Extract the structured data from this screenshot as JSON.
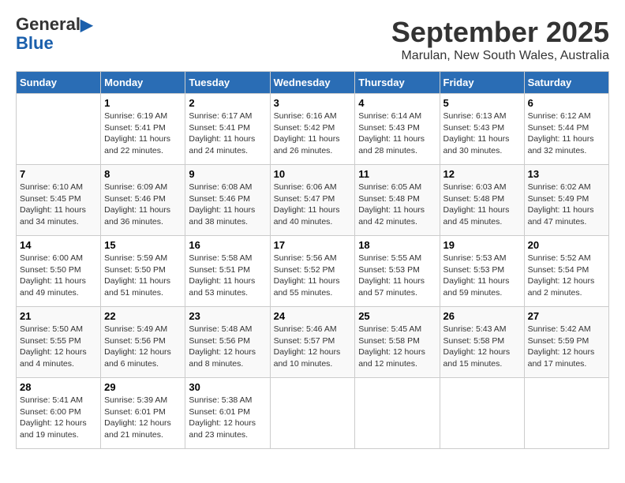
{
  "logo": {
    "line1": "General",
    "line2": "Blue"
  },
  "title": "September 2025",
  "location": "Marulan, New South Wales, Australia",
  "days_of_week": [
    "Sunday",
    "Monday",
    "Tuesday",
    "Wednesday",
    "Thursday",
    "Friday",
    "Saturday"
  ],
  "weeks": [
    [
      {
        "day": "",
        "info": ""
      },
      {
        "day": "1",
        "info": "Sunrise: 6:19 AM\nSunset: 5:41 PM\nDaylight: 11 hours\nand 22 minutes."
      },
      {
        "day": "2",
        "info": "Sunrise: 6:17 AM\nSunset: 5:41 PM\nDaylight: 11 hours\nand 24 minutes."
      },
      {
        "day": "3",
        "info": "Sunrise: 6:16 AM\nSunset: 5:42 PM\nDaylight: 11 hours\nand 26 minutes."
      },
      {
        "day": "4",
        "info": "Sunrise: 6:14 AM\nSunset: 5:43 PM\nDaylight: 11 hours\nand 28 minutes."
      },
      {
        "day": "5",
        "info": "Sunrise: 6:13 AM\nSunset: 5:43 PM\nDaylight: 11 hours\nand 30 minutes."
      },
      {
        "day": "6",
        "info": "Sunrise: 6:12 AM\nSunset: 5:44 PM\nDaylight: 11 hours\nand 32 minutes."
      }
    ],
    [
      {
        "day": "7",
        "info": "Sunrise: 6:10 AM\nSunset: 5:45 PM\nDaylight: 11 hours\nand 34 minutes."
      },
      {
        "day": "8",
        "info": "Sunrise: 6:09 AM\nSunset: 5:46 PM\nDaylight: 11 hours\nand 36 minutes."
      },
      {
        "day": "9",
        "info": "Sunrise: 6:08 AM\nSunset: 5:46 PM\nDaylight: 11 hours\nand 38 minutes."
      },
      {
        "day": "10",
        "info": "Sunrise: 6:06 AM\nSunset: 5:47 PM\nDaylight: 11 hours\nand 40 minutes."
      },
      {
        "day": "11",
        "info": "Sunrise: 6:05 AM\nSunset: 5:48 PM\nDaylight: 11 hours\nand 42 minutes."
      },
      {
        "day": "12",
        "info": "Sunrise: 6:03 AM\nSunset: 5:48 PM\nDaylight: 11 hours\nand 45 minutes."
      },
      {
        "day": "13",
        "info": "Sunrise: 6:02 AM\nSunset: 5:49 PM\nDaylight: 11 hours\nand 47 minutes."
      }
    ],
    [
      {
        "day": "14",
        "info": "Sunrise: 6:00 AM\nSunset: 5:50 PM\nDaylight: 11 hours\nand 49 minutes."
      },
      {
        "day": "15",
        "info": "Sunrise: 5:59 AM\nSunset: 5:50 PM\nDaylight: 11 hours\nand 51 minutes."
      },
      {
        "day": "16",
        "info": "Sunrise: 5:58 AM\nSunset: 5:51 PM\nDaylight: 11 hours\nand 53 minutes."
      },
      {
        "day": "17",
        "info": "Sunrise: 5:56 AM\nSunset: 5:52 PM\nDaylight: 11 hours\nand 55 minutes."
      },
      {
        "day": "18",
        "info": "Sunrise: 5:55 AM\nSunset: 5:53 PM\nDaylight: 11 hours\nand 57 minutes."
      },
      {
        "day": "19",
        "info": "Sunrise: 5:53 AM\nSunset: 5:53 PM\nDaylight: 11 hours\nand 59 minutes."
      },
      {
        "day": "20",
        "info": "Sunrise: 5:52 AM\nSunset: 5:54 PM\nDaylight: 12 hours\nand 2 minutes."
      }
    ],
    [
      {
        "day": "21",
        "info": "Sunrise: 5:50 AM\nSunset: 5:55 PM\nDaylight: 12 hours\nand 4 minutes."
      },
      {
        "day": "22",
        "info": "Sunrise: 5:49 AM\nSunset: 5:56 PM\nDaylight: 12 hours\nand 6 minutes."
      },
      {
        "day": "23",
        "info": "Sunrise: 5:48 AM\nSunset: 5:56 PM\nDaylight: 12 hours\nand 8 minutes."
      },
      {
        "day": "24",
        "info": "Sunrise: 5:46 AM\nSunset: 5:57 PM\nDaylight: 12 hours\nand 10 minutes."
      },
      {
        "day": "25",
        "info": "Sunrise: 5:45 AM\nSunset: 5:58 PM\nDaylight: 12 hours\nand 12 minutes."
      },
      {
        "day": "26",
        "info": "Sunrise: 5:43 AM\nSunset: 5:58 PM\nDaylight: 12 hours\nand 15 minutes."
      },
      {
        "day": "27",
        "info": "Sunrise: 5:42 AM\nSunset: 5:59 PM\nDaylight: 12 hours\nand 17 minutes."
      }
    ],
    [
      {
        "day": "28",
        "info": "Sunrise: 5:41 AM\nSunset: 6:00 PM\nDaylight: 12 hours\nand 19 minutes."
      },
      {
        "day": "29",
        "info": "Sunrise: 5:39 AM\nSunset: 6:01 PM\nDaylight: 12 hours\nand 21 minutes."
      },
      {
        "day": "30",
        "info": "Sunrise: 5:38 AM\nSunset: 6:01 PM\nDaylight: 12 hours\nand 23 minutes."
      },
      {
        "day": "",
        "info": ""
      },
      {
        "day": "",
        "info": ""
      },
      {
        "day": "",
        "info": ""
      },
      {
        "day": "",
        "info": ""
      }
    ]
  ]
}
